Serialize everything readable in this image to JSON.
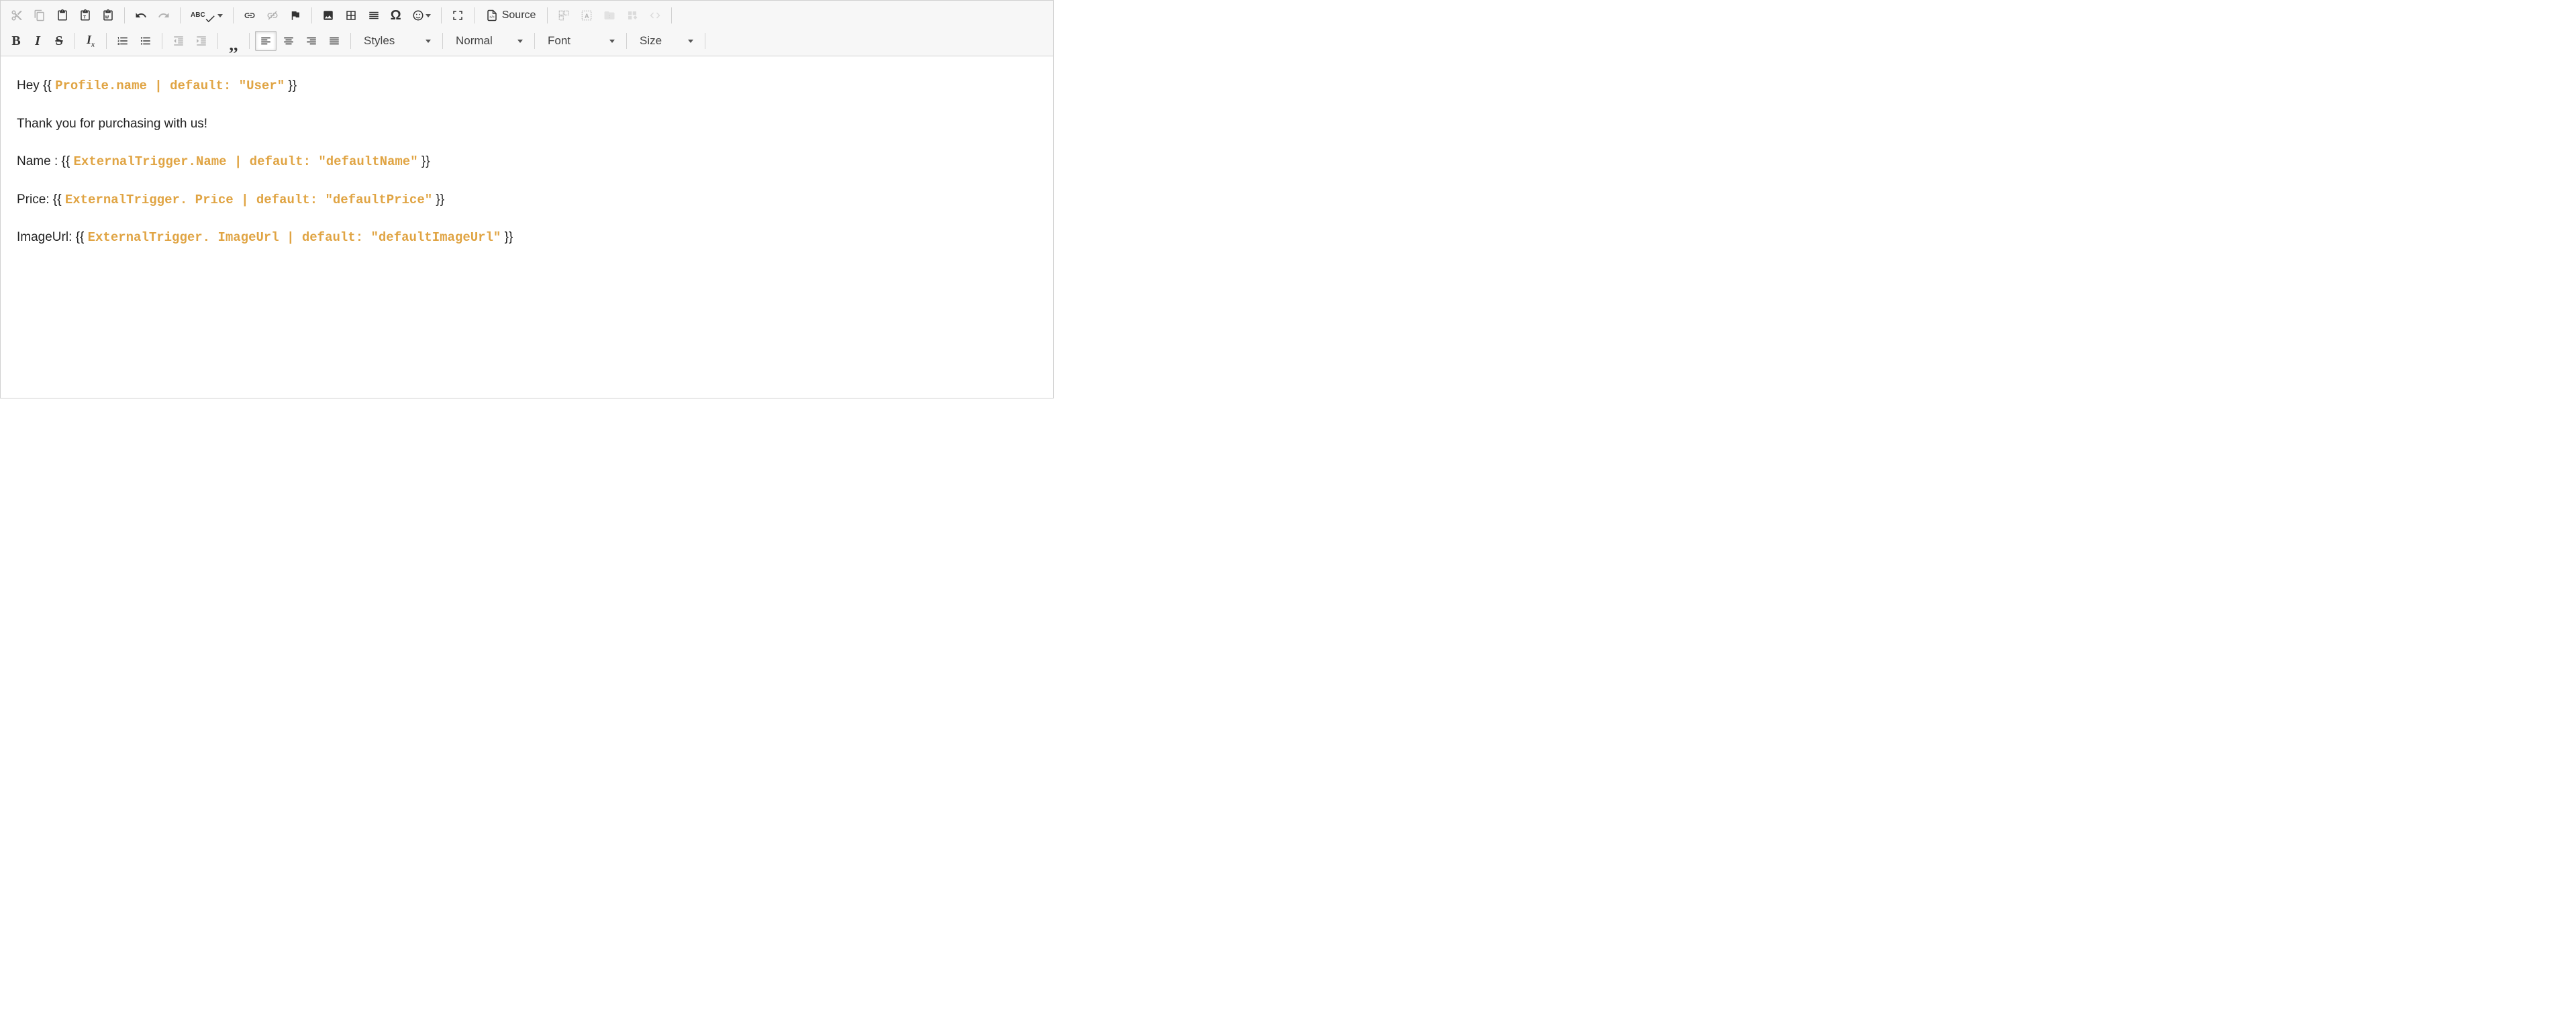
{
  "toolbar": {
    "source_label": "Source",
    "styles_label": "Styles",
    "format_label": "Normal",
    "font_label": "Font",
    "size_label": "Size",
    "abc_label": "ABC"
  },
  "content": {
    "line1_prefix": "Hey ",
    "line1_open": "{{ ",
    "line1_token": "Profile.name | default: \"User\"",
    "line1_close": " }}",
    "line2": "Thank you for purchasing with us!",
    "line3_prefix": "Name : ",
    "line3_open": "{{ ",
    "line3_token": "ExternalTrigger.Name | default: \"defaultName\"",
    "line3_close": " }}",
    "line4_prefix": "Price: ",
    "line4_open": "{{ ",
    "line4_token": "ExternalTrigger. Price | default: \"defaultPrice\"",
    "line4_close": " }}",
    "line5_prefix": "ImageUrl: ",
    "line5_open": "{{ ",
    "line5_token": "ExternalTrigger. ImageUrl | default: \"defaultImageUrl\"",
    "line5_close": " }}"
  }
}
